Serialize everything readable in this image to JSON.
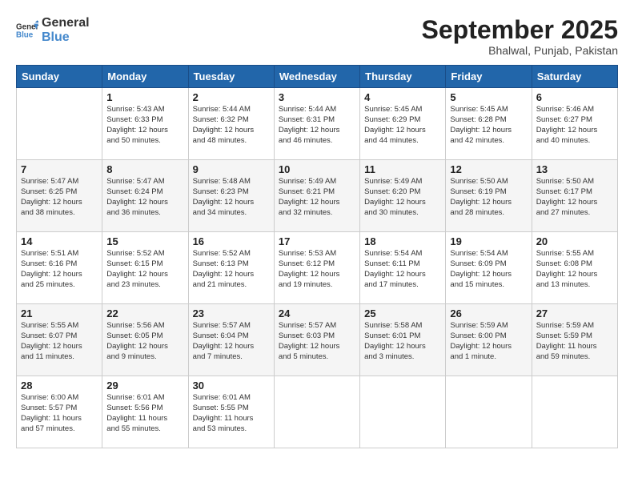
{
  "logo": {
    "general": "General",
    "blue": "Blue"
  },
  "title": "September 2025",
  "subtitle": "Bhalwal, Punjab, Pakistan",
  "days_header": [
    "Sunday",
    "Monday",
    "Tuesday",
    "Wednesday",
    "Thursday",
    "Friday",
    "Saturday"
  ],
  "weeks": [
    [
      {
        "num": "",
        "info": ""
      },
      {
        "num": "1",
        "info": "Sunrise: 5:43 AM\nSunset: 6:33 PM\nDaylight: 12 hours\nand 50 minutes."
      },
      {
        "num": "2",
        "info": "Sunrise: 5:44 AM\nSunset: 6:32 PM\nDaylight: 12 hours\nand 48 minutes."
      },
      {
        "num": "3",
        "info": "Sunrise: 5:44 AM\nSunset: 6:31 PM\nDaylight: 12 hours\nand 46 minutes."
      },
      {
        "num": "4",
        "info": "Sunrise: 5:45 AM\nSunset: 6:29 PM\nDaylight: 12 hours\nand 44 minutes."
      },
      {
        "num": "5",
        "info": "Sunrise: 5:45 AM\nSunset: 6:28 PM\nDaylight: 12 hours\nand 42 minutes."
      },
      {
        "num": "6",
        "info": "Sunrise: 5:46 AM\nSunset: 6:27 PM\nDaylight: 12 hours\nand 40 minutes."
      }
    ],
    [
      {
        "num": "7",
        "info": "Sunrise: 5:47 AM\nSunset: 6:25 PM\nDaylight: 12 hours\nand 38 minutes."
      },
      {
        "num": "8",
        "info": "Sunrise: 5:47 AM\nSunset: 6:24 PM\nDaylight: 12 hours\nand 36 minutes."
      },
      {
        "num": "9",
        "info": "Sunrise: 5:48 AM\nSunset: 6:23 PM\nDaylight: 12 hours\nand 34 minutes."
      },
      {
        "num": "10",
        "info": "Sunrise: 5:49 AM\nSunset: 6:21 PM\nDaylight: 12 hours\nand 32 minutes."
      },
      {
        "num": "11",
        "info": "Sunrise: 5:49 AM\nSunset: 6:20 PM\nDaylight: 12 hours\nand 30 minutes."
      },
      {
        "num": "12",
        "info": "Sunrise: 5:50 AM\nSunset: 6:19 PM\nDaylight: 12 hours\nand 28 minutes."
      },
      {
        "num": "13",
        "info": "Sunrise: 5:50 AM\nSunset: 6:17 PM\nDaylight: 12 hours\nand 27 minutes."
      }
    ],
    [
      {
        "num": "14",
        "info": "Sunrise: 5:51 AM\nSunset: 6:16 PM\nDaylight: 12 hours\nand 25 minutes."
      },
      {
        "num": "15",
        "info": "Sunrise: 5:52 AM\nSunset: 6:15 PM\nDaylight: 12 hours\nand 23 minutes."
      },
      {
        "num": "16",
        "info": "Sunrise: 5:52 AM\nSunset: 6:13 PM\nDaylight: 12 hours\nand 21 minutes."
      },
      {
        "num": "17",
        "info": "Sunrise: 5:53 AM\nSunset: 6:12 PM\nDaylight: 12 hours\nand 19 minutes."
      },
      {
        "num": "18",
        "info": "Sunrise: 5:54 AM\nSunset: 6:11 PM\nDaylight: 12 hours\nand 17 minutes."
      },
      {
        "num": "19",
        "info": "Sunrise: 5:54 AM\nSunset: 6:09 PM\nDaylight: 12 hours\nand 15 minutes."
      },
      {
        "num": "20",
        "info": "Sunrise: 5:55 AM\nSunset: 6:08 PM\nDaylight: 12 hours\nand 13 minutes."
      }
    ],
    [
      {
        "num": "21",
        "info": "Sunrise: 5:55 AM\nSunset: 6:07 PM\nDaylight: 12 hours\nand 11 minutes."
      },
      {
        "num": "22",
        "info": "Sunrise: 5:56 AM\nSunset: 6:05 PM\nDaylight: 12 hours\nand 9 minutes."
      },
      {
        "num": "23",
        "info": "Sunrise: 5:57 AM\nSunset: 6:04 PM\nDaylight: 12 hours\nand 7 minutes."
      },
      {
        "num": "24",
        "info": "Sunrise: 5:57 AM\nSunset: 6:03 PM\nDaylight: 12 hours\nand 5 minutes."
      },
      {
        "num": "25",
        "info": "Sunrise: 5:58 AM\nSunset: 6:01 PM\nDaylight: 12 hours\nand 3 minutes."
      },
      {
        "num": "26",
        "info": "Sunrise: 5:59 AM\nSunset: 6:00 PM\nDaylight: 12 hours\nand 1 minute."
      },
      {
        "num": "27",
        "info": "Sunrise: 5:59 AM\nSunset: 5:59 PM\nDaylight: 11 hours\nand 59 minutes."
      }
    ],
    [
      {
        "num": "28",
        "info": "Sunrise: 6:00 AM\nSunset: 5:57 PM\nDaylight: 11 hours\nand 57 minutes."
      },
      {
        "num": "29",
        "info": "Sunrise: 6:01 AM\nSunset: 5:56 PM\nDaylight: 11 hours\nand 55 minutes."
      },
      {
        "num": "30",
        "info": "Sunrise: 6:01 AM\nSunset: 5:55 PM\nDaylight: 11 hours\nand 53 minutes."
      },
      {
        "num": "",
        "info": ""
      },
      {
        "num": "",
        "info": ""
      },
      {
        "num": "",
        "info": ""
      },
      {
        "num": "",
        "info": ""
      }
    ]
  ]
}
